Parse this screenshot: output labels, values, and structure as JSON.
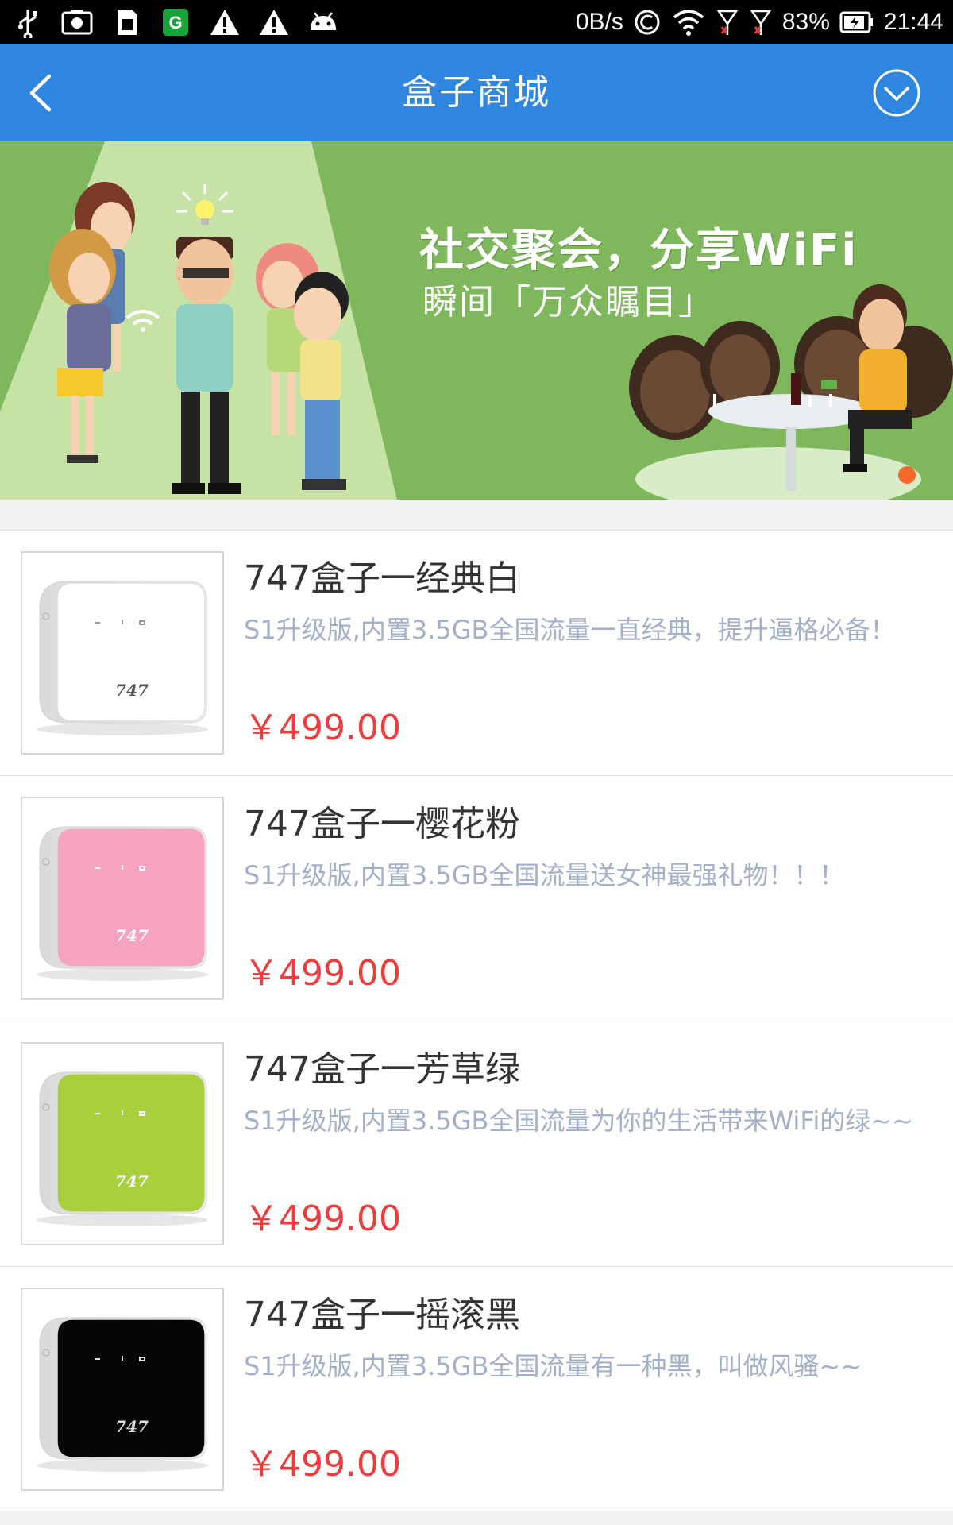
{
  "status_bar": {
    "net_speed": "0B/s",
    "battery": "83%",
    "time": "21:44",
    "icons": [
      "usb-icon",
      "screenshot-icon",
      "sim-icon",
      "app-icon",
      "warning-icon",
      "warning-icon",
      "android-icon",
      "c-icon",
      "wifi-icon",
      "signal-icon",
      "signal-icon",
      "battery-icon"
    ]
  },
  "appbar": {
    "title": "盒子商城",
    "back_icon": "chevron-left-icon",
    "menu_icon": "chevron-down-circle-icon",
    "color": "#2e86de"
  },
  "banner": {
    "headline": "社交聚会，分享WiFi",
    "subline": "瞬间「万众瞩目」",
    "indicator_color": "#f5682a",
    "background": "#7eb75c"
  },
  "products": [
    {
      "name": "747盒子一经典白",
      "desc": "S1升级版,内置3.5GB全国流量一直经典，提升逼格必备！",
      "price": "￥499.00",
      "color": "#ffffff"
    },
    {
      "name": "747盒子一樱花粉",
      "desc": "S1升级版,内置3.5GB全国流量送女神最强礼物！！！",
      "price": "￥499.00",
      "color": "#f5a3bf"
    },
    {
      "name": "747盒子一芳草绿",
      "desc": "S1升级版,内置3.5GB全国流量为你的生活带来WiFi的绿~~",
      "price": "￥499.00",
      "color": "#a8cf3c"
    },
    {
      "name": "747盒子一摇滚黑",
      "desc": "S1升级版,内置3.5GB全国流量有一种黑，叫做风骚~~",
      "price": "￥499.00",
      "color": "#050505"
    }
  ],
  "accent_price_color": "#ef3b3b",
  "device_label": "747"
}
